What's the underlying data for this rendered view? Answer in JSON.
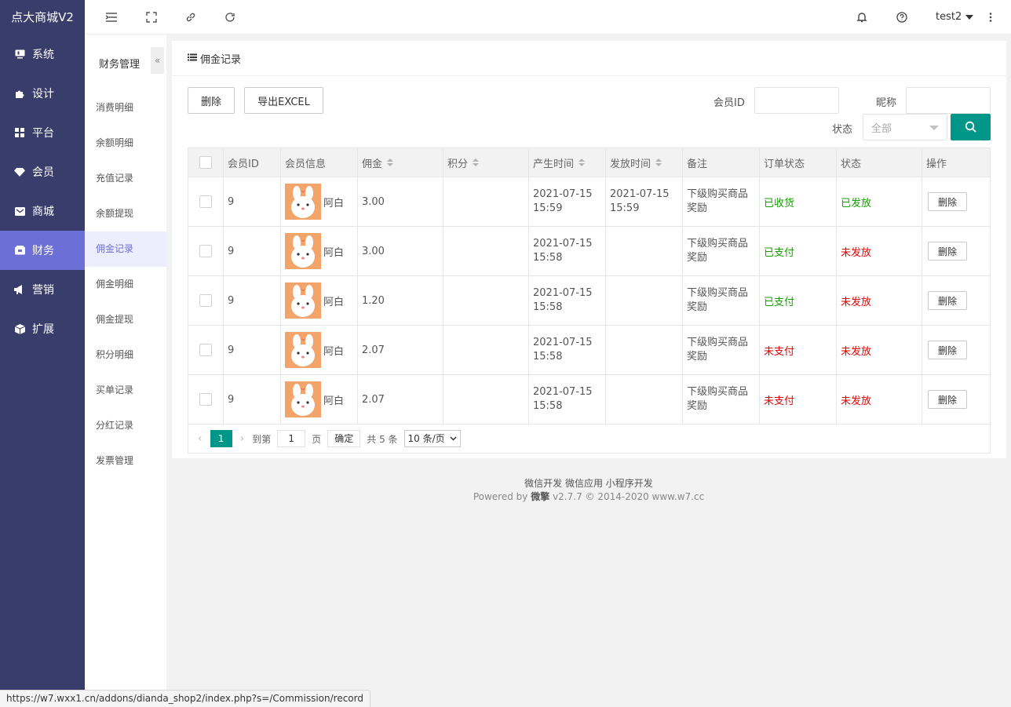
{
  "brand": "点大商城V2",
  "nav": [
    {
      "label": "系统",
      "icon": "monitor-icon"
    },
    {
      "label": "设计",
      "icon": "puzzle-icon"
    },
    {
      "label": "平台",
      "icon": "grid-icon"
    },
    {
      "label": "会员",
      "icon": "diamond-icon"
    },
    {
      "label": "商城",
      "icon": "mail-icon"
    },
    {
      "label": "财务",
      "icon": "wallet-icon",
      "active": true
    },
    {
      "label": "营销",
      "icon": "megaphone-icon"
    },
    {
      "label": "扩展",
      "icon": "cube-icon"
    }
  ],
  "header": {
    "user": "test2"
  },
  "subnav": {
    "title": "财务管理",
    "collapse": "«",
    "items": [
      "消费明细",
      "余额明细",
      "充值记录",
      "余额提现",
      "佣金记录",
      "佣金明细",
      "佣金提现",
      "积分明细",
      "买单记录",
      "分红记录",
      "发票管理"
    ],
    "active_index": 4
  },
  "card": {
    "title": "佣金记录",
    "delete_btn": "删除",
    "export_btn": "导出EXCEL",
    "filter": {
      "member_id_label": "会员ID",
      "member_id_value": "",
      "nickname_label": "昵称",
      "nickname_value": "",
      "status_label": "状态",
      "status_value": "全部"
    }
  },
  "table": {
    "columns": [
      "会员ID",
      "会员信息",
      "佣金",
      "积分",
      "产生时间",
      "发放时间",
      "备注",
      "订单状态",
      "状态",
      "操作"
    ],
    "rows": [
      {
        "member_id": "9",
        "nickname": "阿白",
        "commission": "3.00",
        "points": "",
        "created": "2021-07-15 15:59",
        "issued": "2021-07-15 15:59",
        "remark": "下级购买商品奖励",
        "order_status": "已收货",
        "order_status_color": "#15a000",
        "status": "已发放",
        "status_color": "#15a000",
        "action": "删除"
      },
      {
        "member_id": "9",
        "nickname": "阿白",
        "commission": "3.00",
        "points": "",
        "created": "2021-07-15 15:58",
        "issued": "",
        "remark": "下级购买商品奖励",
        "order_status": "已支付",
        "order_status_color": "#15a000",
        "status": "未发放",
        "status_color": "#e60000",
        "action": "删除"
      },
      {
        "member_id": "9",
        "nickname": "阿白",
        "commission": "1.20",
        "points": "",
        "created": "2021-07-15 15:58",
        "issued": "",
        "remark": "下级购买商品奖励",
        "order_status": "已支付",
        "order_status_color": "#15a000",
        "status": "未发放",
        "status_color": "#e60000",
        "action": "删除"
      },
      {
        "member_id": "9",
        "nickname": "阿白",
        "commission": "2.07",
        "points": "",
        "created": "2021-07-15 15:58",
        "issued": "",
        "remark": "下级购买商品奖励",
        "order_status": "未支付",
        "order_status_color": "#e60000",
        "status": "未发放",
        "status_color": "#e60000",
        "action": "删除"
      },
      {
        "member_id": "9",
        "nickname": "阿白",
        "commission": "2.07",
        "points": "",
        "created": "2021-07-15 15:58",
        "issued": "",
        "remark": "下级购买商品奖励",
        "order_status": "未支付",
        "order_status_color": "#e60000",
        "status": "未发放",
        "status_color": "#e60000",
        "action": "删除"
      }
    ]
  },
  "pager": {
    "current": "1",
    "goto_label": "到第",
    "goto_value": "1",
    "page_unit": "页",
    "confirm": "确定",
    "total": "共 5 条",
    "page_size": "10 条/页"
  },
  "footer": {
    "links": "微信开发 微信应用 小程序开发",
    "powered_prefix": "Powered by",
    "powered_brand": "微擎",
    "powered_suffix": "v2.7.7 © 2014-2020 www.w7.cc"
  },
  "statusbar": "https://w7.wxx1.cn/addons/dianda_shop2/index.php?s=/Commission/record",
  "colors": {
    "nav_bg": "#393d6b",
    "nav_active": "#6c6fd6",
    "accent": "#009688"
  }
}
